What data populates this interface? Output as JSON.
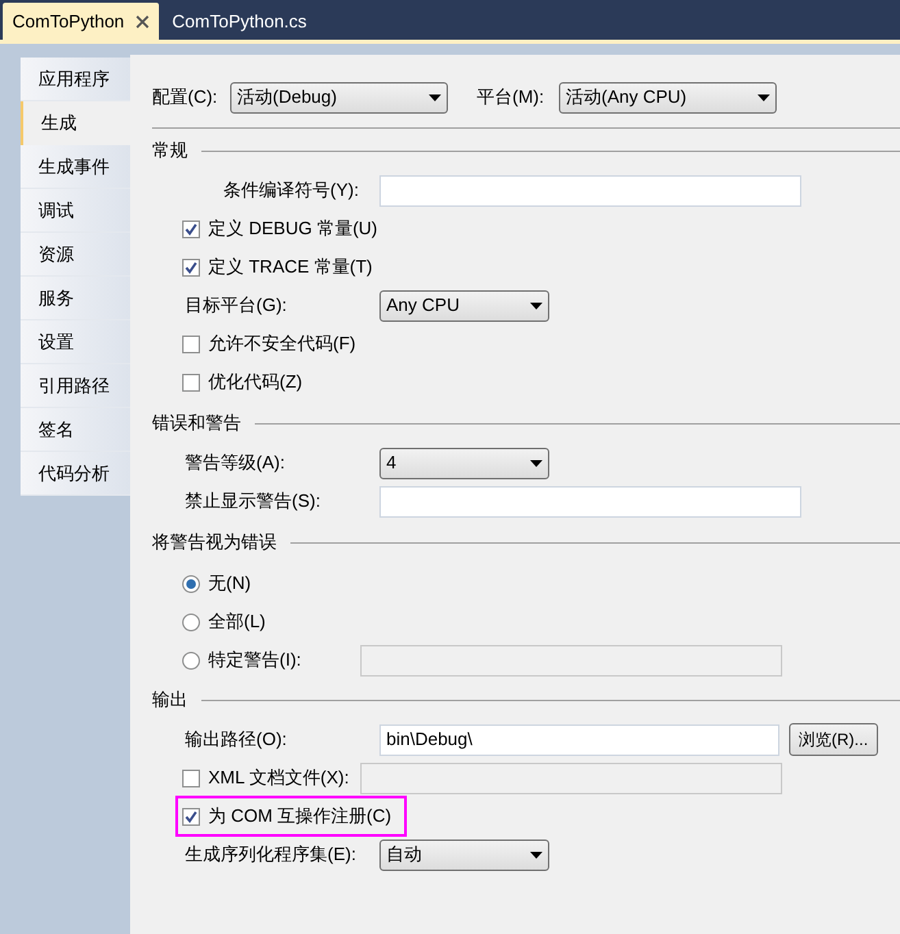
{
  "doc_tabs": [
    {
      "title": "ComToPython",
      "selected": true,
      "closable": true
    },
    {
      "title": "ComToPython.cs",
      "selected": false,
      "closable": false
    }
  ],
  "side_tabs": [
    {
      "label": "应用程序",
      "selected": false
    },
    {
      "label": "生成",
      "selected": true
    },
    {
      "label": "生成事件",
      "selected": false
    },
    {
      "label": "调试",
      "selected": false
    },
    {
      "label": "资源",
      "selected": false
    },
    {
      "label": "服务",
      "selected": false
    },
    {
      "label": "设置",
      "selected": false
    },
    {
      "label": "引用路径",
      "selected": false
    },
    {
      "label": "签名",
      "selected": false
    },
    {
      "label": "代码分析",
      "selected": false
    }
  ],
  "configuration": {
    "label": "配置(C):",
    "value": "活动(Debug)"
  },
  "platform": {
    "label": "平台(M):",
    "value": "活动(Any CPU)"
  },
  "sections": [
    {
      "title": "常规",
      "rows": [
        {
          "kind": "field",
          "label": "条件编译符号(Y):",
          "value": "",
          "disabled": false
        },
        {
          "kind": "check",
          "label": "定义 DEBUG 常量(U)",
          "checked": true,
          "highlighted": false
        },
        {
          "kind": "check",
          "label": "定义 TRACE 常量(T)",
          "checked": true,
          "highlighted": false
        },
        {
          "kind": "dropdown",
          "label": "目标平台(G):",
          "value": "Any CPU"
        },
        {
          "kind": "check",
          "label": "允许不安全代码(F)",
          "checked": false,
          "highlighted": false
        },
        {
          "kind": "check",
          "label": "优化代码(Z)",
          "checked": false,
          "highlighted": false
        }
      ]
    },
    {
      "title": "错误和警告",
      "rows": [
        {
          "kind": "dropdown",
          "label": "警告等级(A):",
          "value": "4"
        },
        {
          "kind": "field",
          "label": "禁止显示警告(S):",
          "value": "",
          "disabled": false
        }
      ]
    },
    {
      "title": "将警告视为错误",
      "rows": [
        {
          "kind": "radio",
          "label": "无(N)",
          "selected": true
        },
        {
          "kind": "radio",
          "label": "全部(L)",
          "selected": false
        },
        {
          "kind": "radio",
          "label": "特定警告(I):",
          "selected": false,
          "field_disabled": true
        }
      ]
    },
    {
      "title": "输出",
      "rows": [
        {
          "kind": "field",
          "label": "输出路径(O):",
          "value": "bin\\Debug\\",
          "disabled": false,
          "button": "浏览(R)..."
        },
        {
          "kind": "checkfield",
          "label": "XML 文档文件(X):",
          "checked": false,
          "disabled": true
        },
        {
          "kind": "check",
          "label": "为 COM 互操作注册(C)",
          "checked": true,
          "highlighted": true
        },
        {
          "kind": "dropdown",
          "label": "生成序列化程序集(E):",
          "value": "自动"
        }
      ]
    }
  ]
}
